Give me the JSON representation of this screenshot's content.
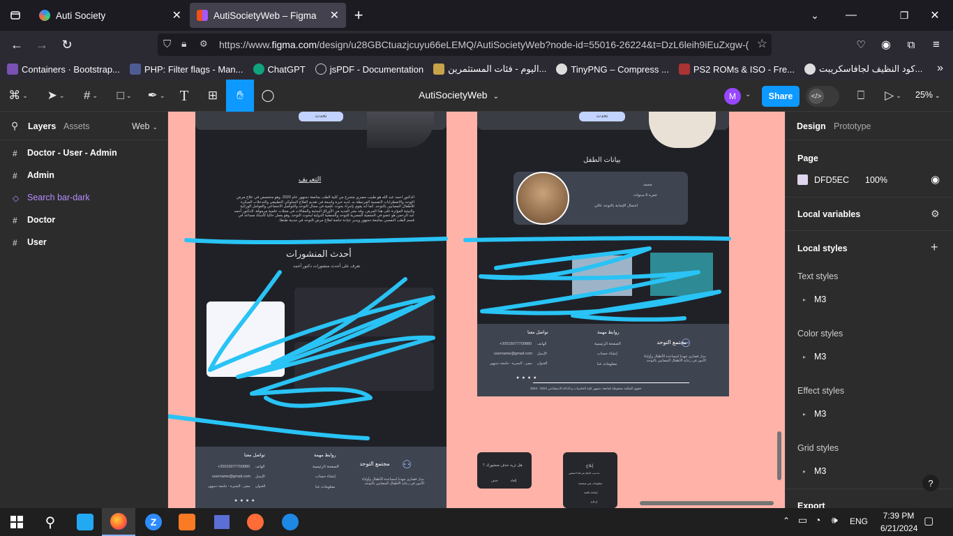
{
  "browser": {
    "tabs": [
      {
        "title": "Auti Society",
        "active": false
      },
      {
        "title": "AutiSocietyWeb – Figma",
        "active": true
      }
    ],
    "url": {
      "prefix": "https://www.",
      "host": "figma.com",
      "path": "/design/u28GBCtuazjcuyu66eLEMQ/AutiSocietyWeb?node-id=55016-26224&t=DzL6leih9iEuZxgw-("
    },
    "bookmarks": [
      {
        "label": "Containers · Bootstrap...",
        "icon": "bootstrap-icon",
        "color": "#7952b3"
      },
      {
        "label": "PHP: Filter flags - Man...",
        "icon": "php-icon",
        "color": "#4f5b93"
      },
      {
        "label": "ChatGPT",
        "icon": "chatgpt-icon",
        "color": "#10a37f"
      },
      {
        "label": "jsPDF - Documentation",
        "icon": "globe-icon",
        "color": "#888888"
      },
      {
        "label": "اليوم - فئات المستثمرين...",
        "icon": "egx-icon",
        "color": "#c8a34a"
      },
      {
        "label": "TinyPNG – Compress ...",
        "icon": "panda-icon",
        "color": "#dddddd"
      },
      {
        "label": "PS2 ROMs & ISO - Fre...",
        "icon": "rom-icon",
        "color": "#aa3333"
      },
      {
        "label": "كود النظيف لجافاسكريبت...",
        "icon": "book-icon",
        "color": "#dddddd"
      }
    ]
  },
  "figma": {
    "title": "AutiSocietyWeb",
    "share": "Share",
    "zoom": "25%",
    "avatar": "M",
    "left": {
      "tabs": [
        "Layers",
        "Assets"
      ],
      "page": "Web",
      "layers": [
        {
          "name": "Doctor - User - Admin",
          "type": "frame"
        },
        {
          "name": "Admin",
          "type": "frame"
        },
        {
          "name": "Search bar-dark",
          "type": "component"
        },
        {
          "name": "Doctor",
          "type": "frame"
        },
        {
          "name": "User",
          "type": "frame"
        }
      ]
    },
    "right": {
      "tabs": [
        "Design",
        "Prototype"
      ],
      "page_label": "Page",
      "page_color": "DFD5EC",
      "page_opacity": "100%",
      "local_variables": "Local variables",
      "local_styles": "Local styles",
      "style_groups": [
        {
          "label": "Text styles",
          "item": "M3"
        },
        {
          "label": "Color styles",
          "item": "M3"
        },
        {
          "label": "Effect styles",
          "item": "M3"
        },
        {
          "label": "Grid styles",
          "item": "M3"
        }
      ],
      "export": "Export",
      "help": "?"
    },
    "canvas": {
      "bg": "#ffb3a8",
      "btn_small": "تحدث",
      "about_title": "التعريف",
      "about_text": "الدكتور أحمد عبد الله هو طبيب مصري متخرج من كلية الطب بجامعة دمنهور عام 2020. وهو متخصص في علاج مرض التوحد والاضطرابات النفسية المرتبطة به. لديه خبرة واسعة في تقديم العلاج السلوكي التطبيقي والتدخلات المبكرة للأطفال المصابين بالتوحد. كما أنه يقوم بإجراء بحوث علمية في مجال التوحد والتواصل الاجتماعي والعوامل الوراثية والبيئية المؤثرة على هذا المرض. وقد نشر العديد من الأوراق البحثية والمقالات في مجلات علمية مرموقة. الدكتور أحمد عبد الرحمن هو عضو في الجمعية المصرية للتوحد والجمعية الدولية لبحوث التوحد. وهو يعمل حاليا كأستاذ مساعد في قسم الطب النفسي بجامعة دمنهور ويدير عيادة خاصة لعلاج مرض التوحد في مدينة طنطا.",
      "posts_title": "أحدث المنشورات",
      "posts_sub": "تعرف على أحدث منشورات دكتور أحمد",
      "child_title": "بيانات الطفل",
      "child_fields": [
        "محمد",
        "عمره 6 سنوات",
        "احتمال الإصابة بالتوحد عالي"
      ],
      "footer": {
        "brand": "مجتمع التوحد",
        "brand_text": "نبذل قصارى جهدنا لمساعدة الأطفال وأولياء الأمور في رعاية الأطفال المصابين بالتوحد.",
        "links_title": "روابط مهمة",
        "links": [
          "الصفحة الرئيسية",
          "إنشاء حساب",
          "معلومات عنا"
        ],
        "contact_title": "تواصل معنا",
        "contact_labels": [
          "الهاتف",
          "الإيميل",
          "العنوان"
        ],
        "contact_values": [
          "+20015077700880",
          "username@gmail.com",
          "مصر - البحيرة - جامعة دمنهور"
        ],
        "copyright": "حقوق الملكية محفوظة لجامعة دمنهور كلية الحاسبات و الذكاء الاصطناعي 2024 - 2023"
      },
      "dialog1_text": "هل تريد حذف منشورك ؟",
      "dialog1_yes": "إلغاء",
      "dialog1_no": "حذف",
      "dialog2_title": "إبلاغ",
      "dialog2_sub": "ما سبب الإبلاغ عن هذا المنشور",
      "dialog2_opts": [
        "معلومات غير صحيحة",
        "إساءة ناقمة",
        "إزعاج"
      ],
      "annotation_color": "#29c3f5"
    }
  },
  "taskbar": {
    "time": "7:39 PM",
    "date": "6/21/2024",
    "lang": "ENG"
  }
}
